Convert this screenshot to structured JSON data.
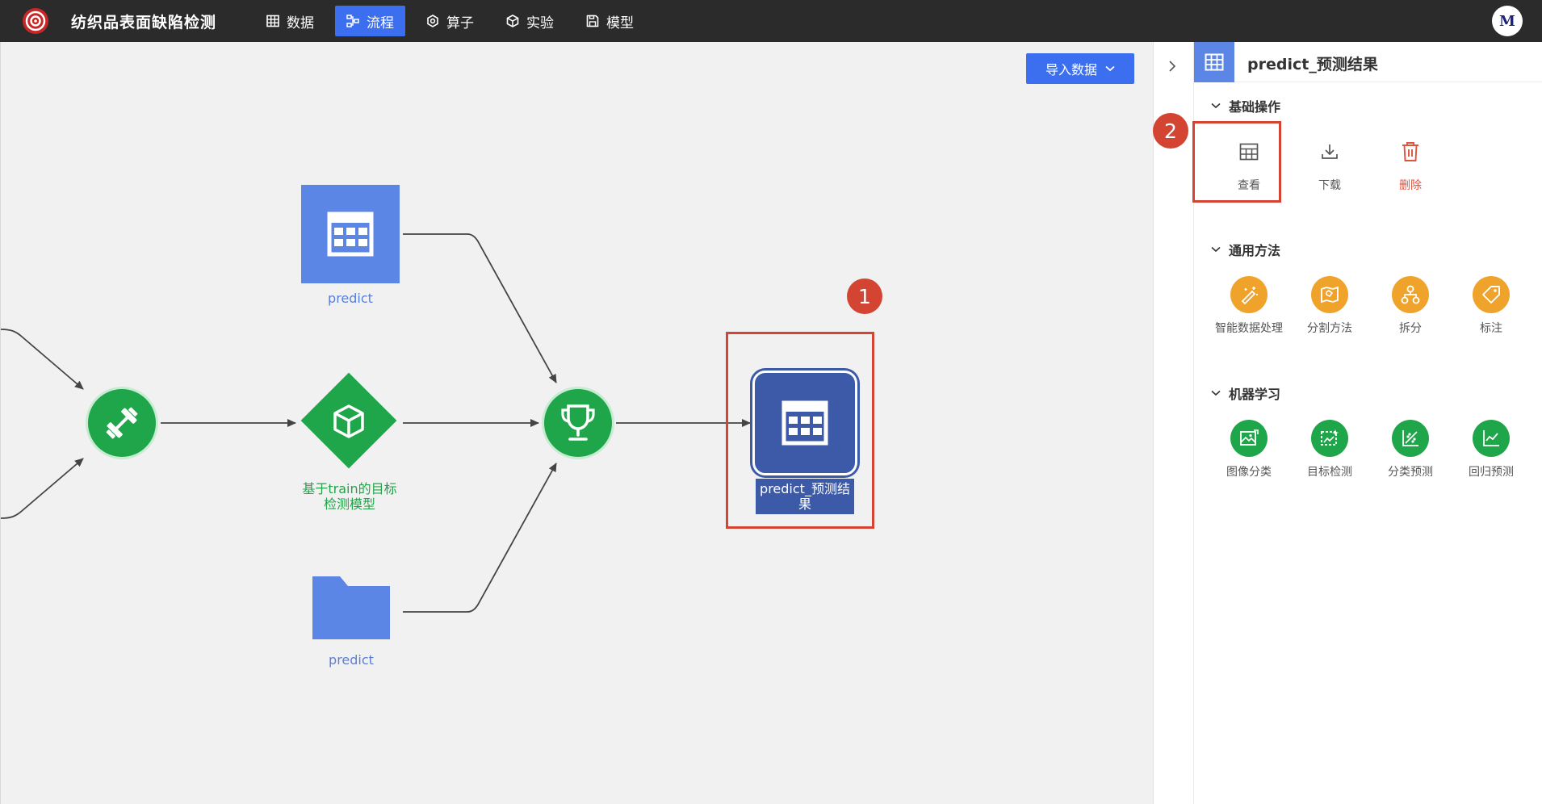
{
  "header": {
    "app_title": "纺织品表面缺陷检测",
    "nav": [
      "数据",
      "流程",
      "算子",
      "实验",
      "模型"
    ],
    "active_nav": "流程",
    "avatar": "M"
  },
  "canvas": {
    "import_button": "导入数据",
    "nodes": {
      "predict_table": "predict",
      "model": "基于train的目标检测模型",
      "model_line1": "基于train的目标",
      "model_line2": "检测模型",
      "predict_folder": "predict",
      "result_line1": "predict_预测结",
      "result_line2": "果"
    },
    "annotation_1": "1"
  },
  "panel": {
    "title": "predict_预测结果",
    "annotation_2": "2",
    "sections": [
      {
        "title": "基础操作",
        "items": [
          "查看",
          "下载",
          "删除"
        ]
      },
      {
        "title": "通用方法",
        "items": [
          "智能数据处理",
          "分割方法",
          "拆分",
          "标注"
        ]
      },
      {
        "title": "机器学习",
        "items": [
          "图像分类",
          "目标检测",
          "分类预测",
          "回归预测"
        ]
      }
    ]
  },
  "colors": {
    "header_bg": "#2b2b2b",
    "accent": "#3c6ff0",
    "node_blue": "#5b86e5",
    "result_blue": "#3d5aa8",
    "node_green": "#1fa64a",
    "orange": "#f0a32b",
    "annotation_red": "#d34433",
    "delete_red": "#e0533f"
  }
}
